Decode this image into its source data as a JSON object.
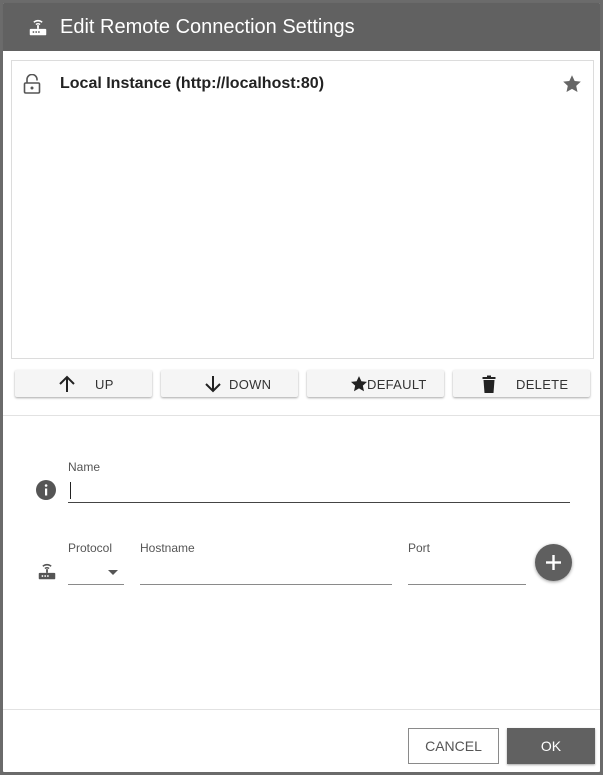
{
  "dialog": {
    "title": "Edit Remote Connection Settings",
    "title_icon": "router-icon"
  },
  "connections": [
    {
      "label": "Local Instance (http://localhost:80)",
      "lock_icon": "lock-open-icon",
      "default_icon": "star-icon",
      "is_default": true
    }
  ],
  "toolbar": {
    "up_label": "UP",
    "down_label": "DOWN",
    "default_label": "DEFAULT",
    "delete_label": "DELETE"
  },
  "form": {
    "name_label": "Name",
    "name_value": "",
    "name_icon": "info-icon",
    "protocol_label": "Protocol",
    "protocol_value": "",
    "hostname_label": "Hostname",
    "hostname_value": "",
    "port_label": "Port",
    "port_value": "",
    "connection_icon": "router-icon",
    "add_icon": "plus-icon"
  },
  "footer": {
    "cancel_label": "CANCEL",
    "ok_label": "OK"
  },
  "colors": {
    "titlebar": "#616161",
    "primary_button": "#616161",
    "icon": "#555555"
  }
}
